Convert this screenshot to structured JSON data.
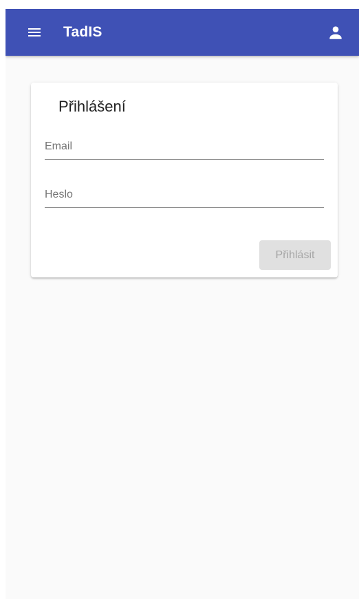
{
  "app": {
    "title": "TadIS",
    "colors": {
      "appbar": "#3f51b5",
      "background": "#fafafa",
      "card": "#ffffff",
      "button_disabled_bg": "#e0e0e0",
      "button_disabled_text": "#a6a6a6"
    },
    "icons": {
      "menu": "menu-icon",
      "account": "account-icon"
    }
  },
  "login": {
    "title": "Přihlášení",
    "email": {
      "value": "",
      "placeholder": "Email"
    },
    "password": {
      "value": "",
      "placeholder": "Heslo"
    },
    "submit_label": "Přihlásit",
    "submit_disabled": true
  }
}
